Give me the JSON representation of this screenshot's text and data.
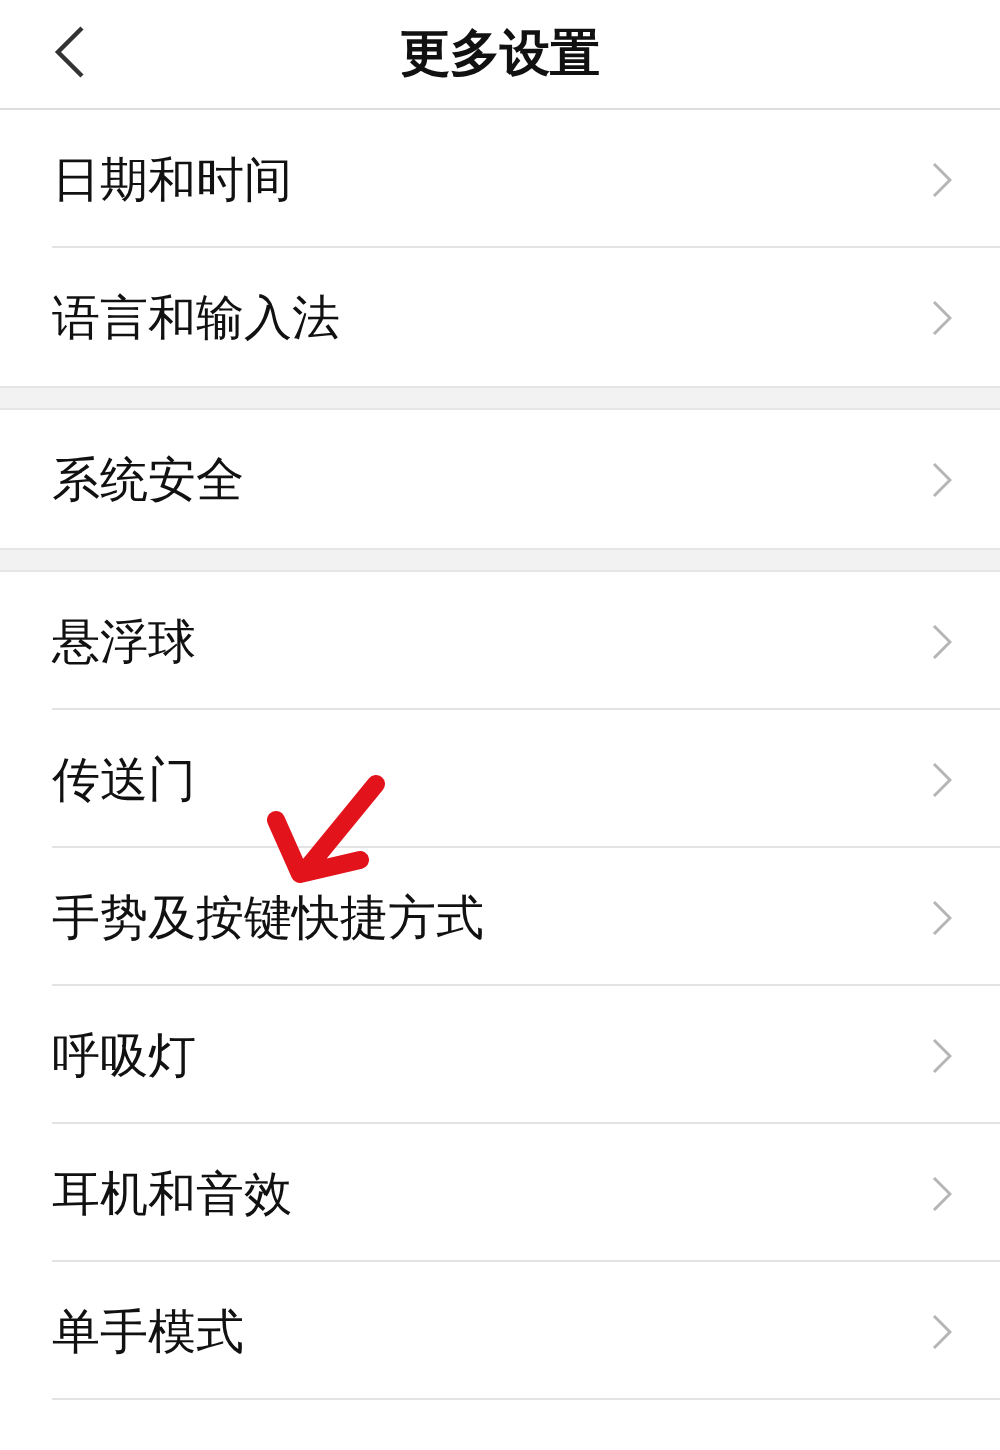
{
  "header": {
    "title": "更多设置"
  },
  "groups": [
    {
      "items": [
        {
          "label": "日期和时间"
        },
        {
          "label": "语言和输入法"
        }
      ]
    },
    {
      "items": [
        {
          "label": "系统安全"
        }
      ]
    },
    {
      "items": [
        {
          "label": "悬浮球"
        },
        {
          "label": "传送门"
        },
        {
          "label": "手势及按键快捷方式"
        },
        {
          "label": "呼吸灯"
        },
        {
          "label": "耳机和音效"
        },
        {
          "label": "单手模式"
        }
      ]
    }
  ]
}
